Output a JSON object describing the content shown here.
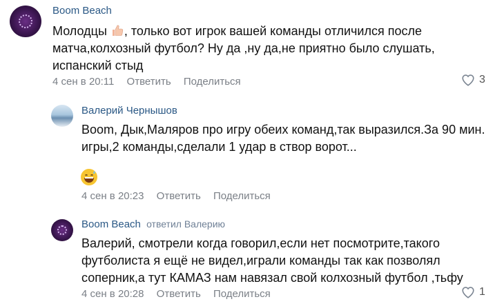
{
  "comments": [
    {
      "author": "Boom Beach",
      "reply_to": "",
      "text_before_emoji": "Молодцы ",
      "text_after_emoji": ", только вот игрок вашей команды отличился после матча,колхозный футбол? Ну да ,ну да,не приятно было слушать, испанский стыд",
      "emoji_inline": "thumbs-up-icon",
      "date": "4 сен в 20:11",
      "reply_label": "Ответить",
      "share_label": "Поделиться",
      "likes": "3"
    },
    {
      "author": "Валерий Чернышов",
      "reply_to": "",
      "text": "Boom, Дык,Маляров про игру обеих команд,так выразился.За 90 мин. игры,2 команды,сделали 1 удар в створ ворот...",
      "emoji": "grinning-sweat-face-icon",
      "date": "4 сен в 20:23",
      "reply_label": "Ответить",
      "share_label": "Поделиться"
    },
    {
      "author": "Boom Beach",
      "reply_to": "ответил Валерию",
      "text": "Валерий, смотрели когда говорил,если нет посмотрите,такого футболиста я ещё не видел,играли команды так как позволял соперник,а тут КАМАЗ нам навязал свой колхозный футбол ,тьфу",
      "date": "4 сен в 20:28",
      "reply_label": "Ответить",
      "share_label": "Поделиться",
      "likes": "1"
    }
  ],
  "colors": {
    "author": "#2a5885",
    "meta": "#7a7f86"
  }
}
